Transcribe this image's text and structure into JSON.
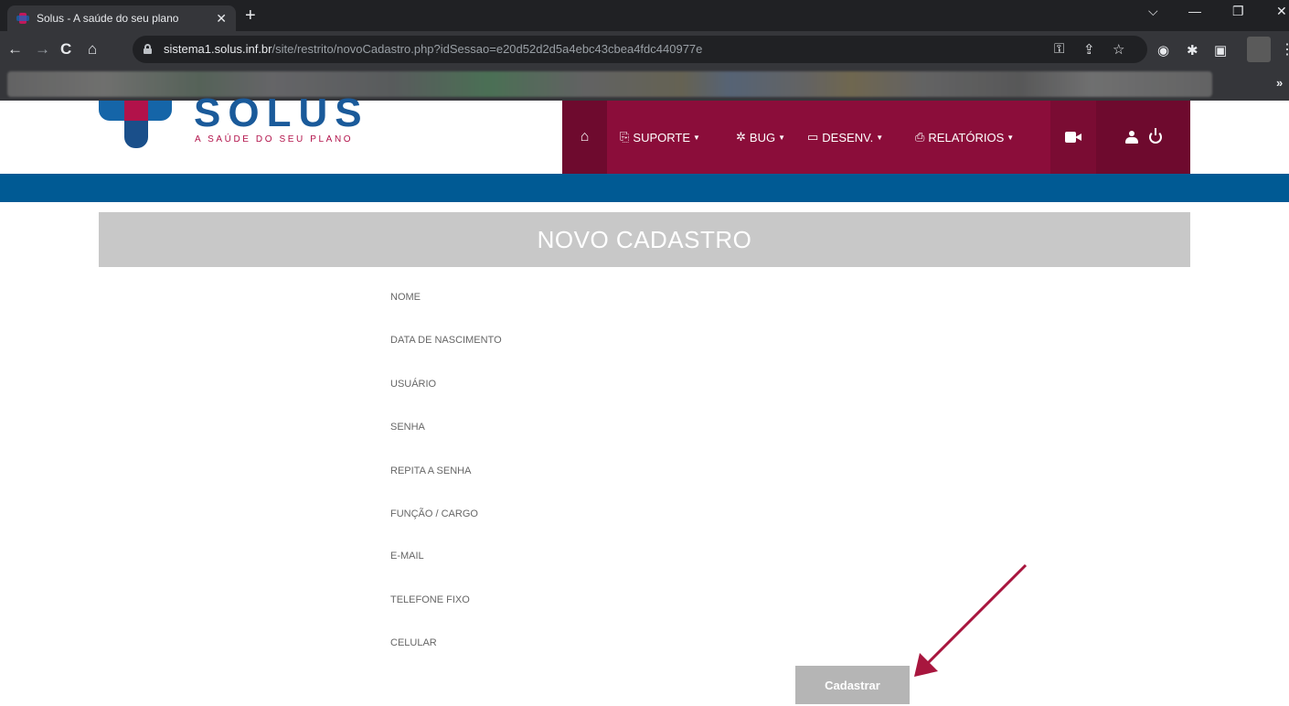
{
  "browser": {
    "tab_title": "Solus - A saúde do seu plano",
    "tab_close": "✕",
    "new_tab": "+",
    "url_host": "sistema1.solus.inf.br",
    "url_path": "/site/restrito/novoCadastro.php?idSessao=e20d52d2d5a4ebc43cbea4fdc440977e",
    "bookmarks_more": "»"
  },
  "site": {
    "logo_text": "SOLUS",
    "logo_tagline": "A SAÚDE DO SEU PLANO",
    "nav": {
      "home_icon": "home-icon",
      "items": [
        {
          "label": "SUPORTE",
          "icon": "support-icon"
        },
        {
          "label": "BUG",
          "icon": "bug-icon"
        },
        {
          "label": "DESENV.",
          "icon": "laptop-icon"
        },
        {
          "label": "RELATÓRIOS",
          "icon": "print-icon"
        }
      ],
      "video_icon": "video-camera-icon",
      "user_icon": "user-icon",
      "power_icon": "power-icon"
    },
    "colors": {
      "nav_bg": "#8b0d3a",
      "nav_dark": "#6e0a2e",
      "band_blue": "#005a94",
      "title_bar_bg": "#c8c8c8",
      "button_bg": "#b5b5b5",
      "arrow": "#a8163e"
    }
  },
  "form": {
    "title": "NOVO CADASTRO",
    "fields": [
      "NOME",
      "DATA DE NASCIMENTO",
      "USUÁRIO",
      "SENHA",
      "REPITA A SENHA",
      "FUNÇÃO / CARGO",
      "E-MAIL",
      "TELEFONE FIXO",
      "CELULAR"
    ],
    "submit_label": "Cadastrar"
  }
}
